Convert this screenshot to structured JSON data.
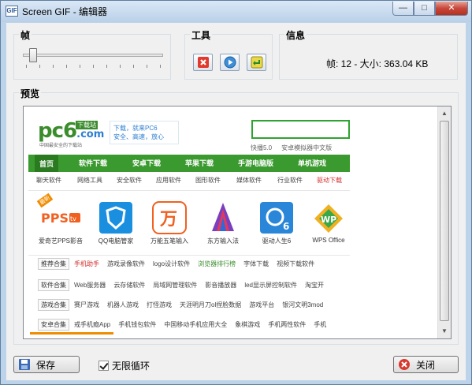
{
  "window": {
    "title": "Screen GIF - 编辑器",
    "app_icon_text": "GIF",
    "min_glyph": "—",
    "max_glyph": "□",
    "close_glyph": "✕"
  },
  "frame_group": {
    "title": "帧",
    "slider_value": 12
  },
  "tools_group": {
    "title": "工具",
    "buttons": [
      {
        "icon": "delete-icon"
      },
      {
        "icon": "play-icon"
      },
      {
        "icon": "undo-icon"
      }
    ]
  },
  "info_group": {
    "title": "信息",
    "text": "帧: 12 - 大小: 363.04 KB"
  },
  "preview_group": {
    "title": "预览"
  },
  "preview_page": {
    "logo_text": "pc6",
    "logo_domain": ".com",
    "logo_badge": "下载站",
    "logo_tagline": "中国最安全的下载站",
    "slogan_line1": "下载，就来PC6",
    "slogan_line2": "安全、高速，放心",
    "search_links": [
      "快播5.0",
      "安卓模拟器中文版"
    ],
    "nav": [
      "首页",
      "软件下载",
      "安卓下载",
      "苹果下载",
      "手游电脑版",
      "单机游戏"
    ],
    "subnav": [
      "聊天软件",
      "网络工具",
      "安全软件",
      "应用软件",
      "图形软件",
      "媒体软件",
      "行业软件",
      "驱动下载"
    ],
    "apps": [
      {
        "label": "爱奇艺PPS影音",
        "icon": "pps-icon"
      },
      {
        "label": "QQ电脑管家",
        "icon": "qq-guard-icon"
      },
      {
        "label": "万能五笔输入",
        "icon": "wubi-icon"
      },
      {
        "label": "东方输入法",
        "icon": "dongfang-icon"
      },
      {
        "label": "驱动人生6",
        "icon": "driver-life-icon"
      },
      {
        "label": "WPS Office",
        "icon": "wps-icon"
      }
    ],
    "app_new_tag": "最新",
    "cat_rows": [
      {
        "tag": "推荐合集",
        "items": [
          "手机助手",
          "游戏录像软件",
          "logo设计软件",
          "浏览器排行榜",
          "字体下载",
          "视频下载软件"
        ]
      },
      {
        "tag": "软件合集",
        "items": [
          "Web服务器",
          "云存储软件",
          "局域网管理软件",
          "影音播放器",
          "led显示屏控制软件",
          "淘宝开"
        ]
      },
      {
        "tag": "游戏合集",
        "items": [
          "赛尸游戏",
          "机器人游戏",
          "打怪游戏",
          "天涯明月刀ol捏脸数据",
          "游戏平台",
          "银河文明3mod"
        ]
      },
      {
        "tag": "安卓合集",
        "items": [
          "戒手机瘾App",
          "手机钱包软件",
          "中国移动手机应用大全",
          "象棋游戏",
          "手机两性软件",
          "手机"
        ]
      }
    ]
  },
  "bottom": {
    "save_label": "保存",
    "loop_label": "无限循环",
    "loop_checked": true,
    "close_label": "关闭"
  }
}
